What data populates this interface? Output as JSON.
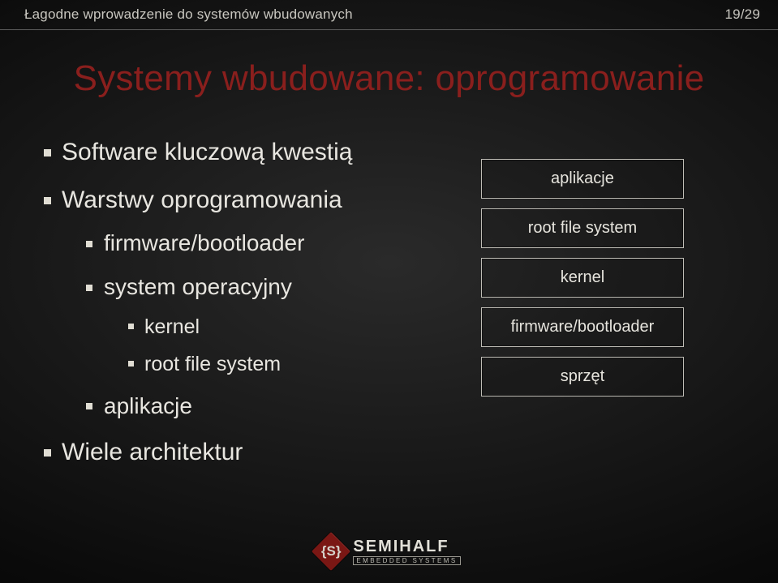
{
  "header": {
    "left": "Łagodne wprowadzenie do systemów wbudowanych",
    "right": "19/29"
  },
  "title": "Systemy wbudowane: oprogramowanie",
  "bullets": {
    "item1": "Software kluczową kwestią",
    "item2": "Warstwy oprogramowania",
    "item2_sub": {
      "a": "firmware/bootloader",
      "b": "system operacyjny",
      "b_sub": {
        "i": "kernel",
        "ii": "root file system"
      },
      "c": "aplikacje"
    },
    "item3": "Wiele architektur"
  },
  "diagram": {
    "layer1": "aplikacje",
    "layer2": "root file system",
    "layer3": "kernel",
    "layer4": "firmware/bootloader",
    "layer5": "sprzęt"
  },
  "footer": {
    "brand": "SEMIHALF",
    "tagline": "EMBEDDED SYSTEMS",
    "mark": "{S}"
  }
}
